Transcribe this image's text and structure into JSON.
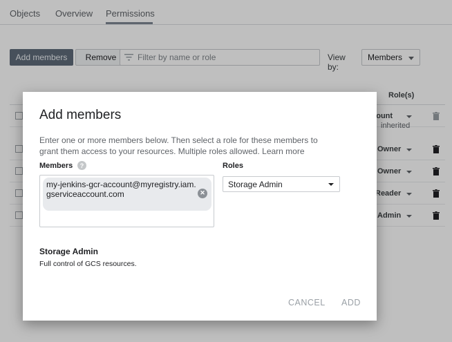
{
  "tabs": [
    {
      "label": "Objects"
    },
    {
      "label": "Overview"
    },
    {
      "label": "Permissions"
    }
  ],
  "toolbar": {
    "add_members_label": "Add members",
    "remove_label": "Remove",
    "filter_placeholder": "Filter by name or role",
    "view_by_label": "View by:",
    "view_by_value": "Members"
  },
  "table": {
    "roles_header": "Role(s)",
    "rows": [
      {
        "role": "ccount",
        "inherited": "inherited"
      },
      {
        "role": "Owner"
      },
      {
        "role": "Owner"
      },
      {
        "role": "Reader"
      },
      {
        "role": "Admin"
      }
    ]
  },
  "dialog": {
    "title": "Add members",
    "description": "Enter one or more members below. Then select a role for these members to grant them access to your resources. Multiple roles allowed.",
    "learn_more": "Learn more",
    "members_label": "Members",
    "member_chip": "my-jenkins-gcr-account@myregistry.iam.gserviceaccount.com",
    "roles_label": "Roles",
    "selected_role": "Storage Admin",
    "role_title": "Storage Admin",
    "role_description": "Full control of GCS resources.",
    "cancel_label": "CANCEL",
    "add_label": "ADD"
  }
}
